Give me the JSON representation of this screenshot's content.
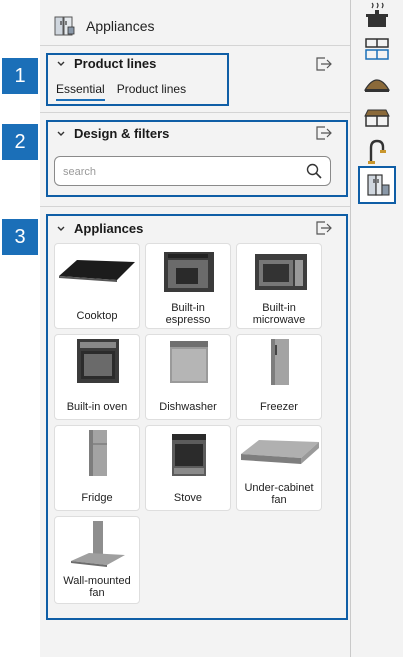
{
  "header": {
    "title": "Appliances"
  },
  "callouts": [
    "1",
    "2",
    "3"
  ],
  "sections": {
    "product_lines": {
      "title": "Product lines",
      "tabs": [
        "Essential",
        "Product lines"
      ]
    },
    "design_filters": {
      "title": "Design & filters",
      "search_placeholder": "search"
    },
    "appliances": {
      "title": "Appliances",
      "items": [
        "Cooktop",
        "Built-in espresso",
        "Built-in microwave",
        "Built-in oven",
        "Dishwasher",
        "Freezer",
        "Fridge",
        "Stove",
        "Under-cabinet fan",
        "Wall-mounted fan"
      ]
    }
  },
  "rail": {
    "icons": [
      "cooking-pot-icon",
      "cabinets-icon",
      "countertop-icon",
      "table-icon",
      "faucet-icon",
      "appliances-icon"
    ],
    "active_index": 5
  },
  "colors": {
    "accent": "#0f5ea6",
    "badge": "#1b6fb8"
  }
}
